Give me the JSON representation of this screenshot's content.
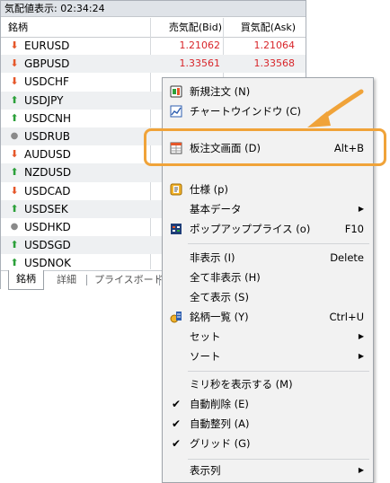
{
  "window": {
    "title": "気配値表示: 02:34:24",
    "headers": {
      "symbol": "銘柄",
      "bid": "売気配(Bid)",
      "ask": "買気配(Ask)"
    },
    "rows": [
      {
        "symbol": "EURUSD",
        "bid": "1.21062",
        "ask": "1.21064",
        "trend": "down"
      },
      {
        "symbol": "GBPUSD",
        "bid": "1.33561",
        "ask": "1.33568",
        "trend": "down"
      },
      {
        "symbol": "USDCHF",
        "bid": "",
        "ask": "",
        "trend": "down"
      },
      {
        "symbol": "USDJPY",
        "bid": "",
        "ask": "",
        "trend": "up"
      },
      {
        "symbol": "USDCNH",
        "bid": "",
        "ask": "",
        "trend": "up"
      },
      {
        "symbol": "USDRUB",
        "bid": "",
        "ask": "",
        "trend": "none"
      },
      {
        "symbol": "AUDUSD",
        "bid": "",
        "ask": "",
        "trend": "down"
      },
      {
        "symbol": "NZDUSD",
        "bid": "",
        "ask": "",
        "trend": "up"
      },
      {
        "symbol": "USDCAD",
        "bid": "",
        "ask": "",
        "trend": "down"
      },
      {
        "symbol": "USDSEK",
        "bid": "",
        "ask": "",
        "trend": "up"
      },
      {
        "symbol": "USDHKD",
        "bid": "",
        "ask": "",
        "trend": "none"
      },
      {
        "symbol": "USDSGD",
        "bid": "",
        "ask": "",
        "trend": "up"
      },
      {
        "symbol": "USDNOK",
        "bid": "",
        "ask": "",
        "trend": "up"
      }
    ],
    "tabs": [
      "銘柄",
      "詳細",
      "プライスボード",
      ""
    ]
  },
  "menu": {
    "items": [
      {
        "label": "新規注文 (N)",
        "shortcut": "",
        "icon": "new-order-icon"
      },
      {
        "label": "チャートウインドウ (C)",
        "shortcut": "",
        "icon": "chart-window-icon"
      },
      {
        "label": "",
        "shortcut": "",
        "icon": "hidden-icon"
      },
      {
        "label": "板注文画面 (D)",
        "shortcut": "Alt+B",
        "icon": "depth-of-market-icon"
      },
      {
        "label": "",
        "shortcut": "",
        "icon": "hidden-icon"
      },
      {
        "label": "仕様 (p)",
        "shortcut": "",
        "icon": "specification-icon"
      },
      {
        "label": "基本データ",
        "shortcut": "",
        "submenu": true
      },
      {
        "label": "ポップアッププライス (o)",
        "shortcut": "F10",
        "icon": "popup-prices-icon"
      },
      {
        "label": "非表示 (I)",
        "shortcut": "Delete"
      },
      {
        "label": "全て非表示 (H)",
        "shortcut": ""
      },
      {
        "label": "全て表示 (S)",
        "shortcut": ""
      },
      {
        "label": "銘柄一覧 (Y)",
        "shortcut": "Ctrl+U",
        "icon": "symbols-icon"
      },
      {
        "label": "セット",
        "shortcut": "",
        "submenu": true
      },
      {
        "label": "ソート",
        "shortcut": "",
        "submenu": true
      },
      {
        "label": "ミリ秒を表示する (M)",
        "shortcut": ""
      },
      {
        "label": "自動削除 (E)",
        "shortcut": "",
        "checked": true
      },
      {
        "label": "自動整列 (A)",
        "shortcut": "",
        "checked": true
      },
      {
        "label": "グリッド (G)",
        "shortcut": "",
        "checked": true
      },
      {
        "label": "表示列",
        "shortcut": "",
        "submenu": true
      }
    ]
  },
  "colors": {
    "accent": "#f0a339",
    "price_red": "#d8252a",
    "up_green": "#2ca03a",
    "down_orange": "#e5572a"
  }
}
